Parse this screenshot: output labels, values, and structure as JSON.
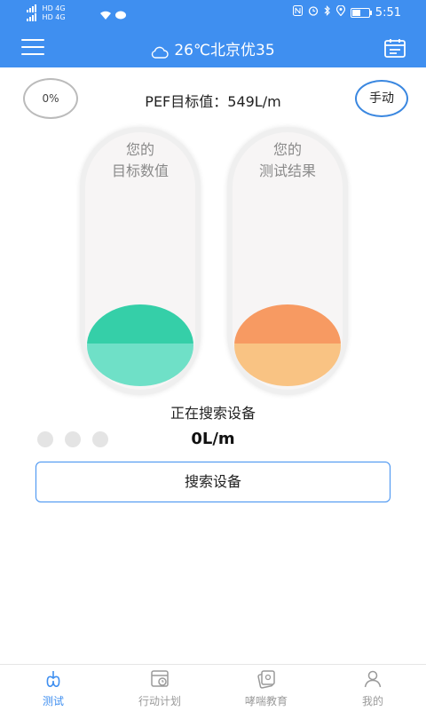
{
  "status_bar": {
    "sim1": "HD 4G",
    "sim2": "HD 4G",
    "time": "5:51",
    "battery_level": 0.55
  },
  "header": {
    "weather": "26℃北京优35"
  },
  "main": {
    "progress_percent": "0%",
    "pef_target": "PEF目标值：549L/m",
    "mode_button": "手动",
    "target_tube": {
      "line1": "您的",
      "line2": "目标数值"
    },
    "result_tube": {
      "line1": "您的",
      "line2": "测试结果"
    },
    "device_status": "正在搜索设备",
    "reading": "0L/m",
    "search_button": "搜索设备"
  },
  "colors": {
    "primary": "#3f8ff0",
    "target_ball_top": "#35cfa8",
    "target_ball_bottom": "#6fe0c7",
    "result_ball_top": "#f79a62",
    "result_ball_bottom": "#f9c383"
  },
  "bottom_nav": [
    {
      "label": "测试",
      "icon": "lungs-icon",
      "active": true
    },
    {
      "label": "行动计划",
      "icon": "plan-icon",
      "active": false
    },
    {
      "label": "哮喘教育",
      "icon": "education-icon",
      "active": false
    },
    {
      "label": "我的",
      "icon": "user-icon",
      "active": false
    }
  ]
}
